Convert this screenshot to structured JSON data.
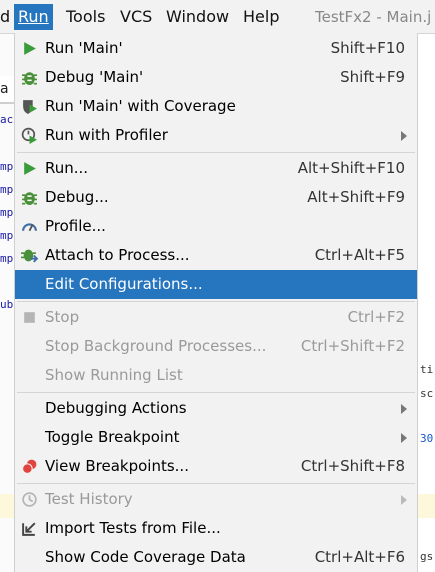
{
  "menubar": {
    "items": [
      {
        "label": "d"
      },
      {
        "label": "Run"
      },
      {
        "label": "Tools"
      },
      {
        "label": "VCS"
      },
      {
        "label": "Window"
      },
      {
        "label": "Help"
      }
    ],
    "window_title": "TestFx2 - Main.j"
  },
  "background": {
    "tab_fragment": "a",
    "left_code": [
      "ac",
      "mp",
      "mp",
      "mp",
      "mp",
      "mp",
      "ub"
    ],
    "right_code": [
      "ti",
      "sc",
      "30",
      "gs"
    ]
  },
  "run_menu": {
    "run_main": {
      "label": "Run 'Main'",
      "shortcut": "Shift+F10"
    },
    "debug_main": {
      "label": "Debug 'Main'",
      "shortcut": "Shift+F9"
    },
    "run_coverage": {
      "label": "Run 'Main' with Coverage"
    },
    "run_profiler": {
      "label": "Run with Profiler"
    },
    "run": {
      "label": "Run...",
      "shortcut": "Alt+Shift+F10"
    },
    "debug": {
      "label": "Debug...",
      "shortcut": "Alt+Shift+F9"
    },
    "profile": {
      "label": "Profile..."
    },
    "attach": {
      "label": "Attach to Process...",
      "shortcut": "Ctrl+Alt+F5"
    },
    "edit_config": {
      "label": "Edit Configurations..."
    },
    "stop": {
      "label": "Stop",
      "shortcut": "Ctrl+F2"
    },
    "stop_bg": {
      "label": "Stop Background Processes...",
      "shortcut": "Ctrl+Shift+F2"
    },
    "show_running": {
      "label": "Show Running List"
    },
    "debugging_actions": {
      "label": "Debugging Actions"
    },
    "toggle_bp": {
      "label": "Toggle Breakpoint"
    },
    "view_bp": {
      "label": "View Breakpoints...",
      "shortcut": "Ctrl+Shift+F8"
    },
    "test_history": {
      "label": "Test History"
    },
    "import_tests": {
      "label": "Import Tests from File..."
    },
    "show_coverage": {
      "label": "Show Code Coverage Data",
      "shortcut": "Ctrl+Alt+F6"
    }
  },
  "colors": {
    "selection": "#2675bf",
    "run_green": "#3a9b3a",
    "debug_green": "#4a8f3a",
    "breakpoint_red": "#e0443e"
  }
}
